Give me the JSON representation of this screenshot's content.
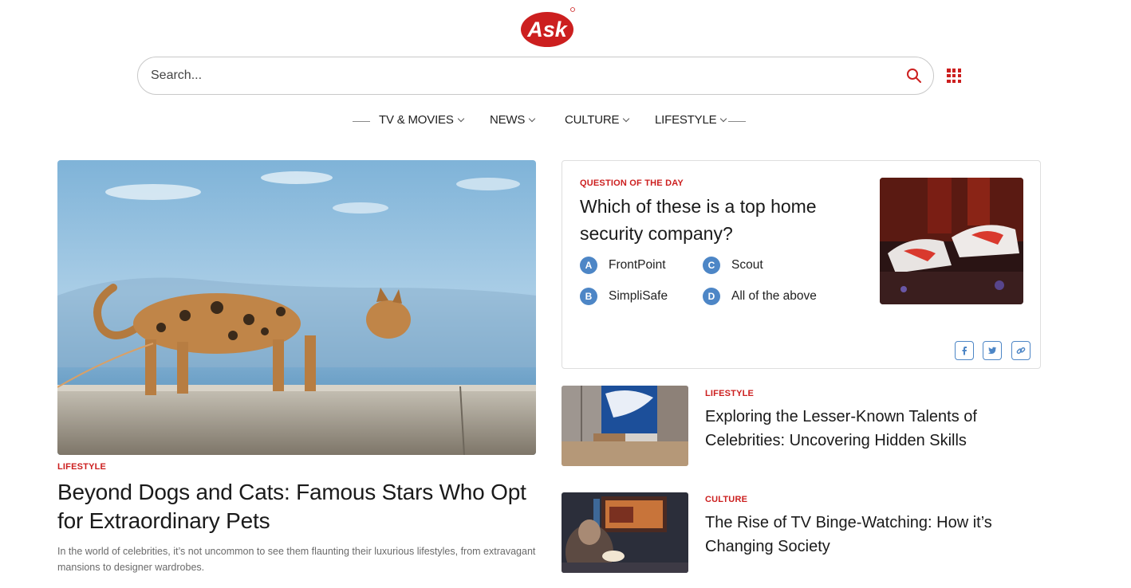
{
  "brand": {
    "logo_text": "Ask",
    "color": "#cc1f1f"
  },
  "search": {
    "placeholder": "Search...",
    "icon": "search-icon"
  },
  "apps_icon": "grid-icon",
  "nav": {
    "items": [
      {
        "label": "TV & MOVIES"
      },
      {
        "label": "NEWS"
      },
      {
        "label": "CULTURE"
      },
      {
        "label": "LIFESTYLE"
      }
    ]
  },
  "hero": {
    "category": "LIFESTYLE",
    "title": "Beyond Dogs and Cats: Famous Stars Who Opt for Extraordinary Pets",
    "description": "In the world of celebrities, it’s not uncommon to see them flaunting their luxurious lifestyles, from extravagant mansions to designer wardrobes."
  },
  "question": {
    "kicker": "QUESTION OF THE DAY",
    "title": "Which of these is a top home security company?",
    "options": [
      {
        "letter": "A",
        "text": "FrontPoint"
      },
      {
        "letter": "B",
        "text": "SimpliSafe"
      },
      {
        "letter": "C",
        "text": "Scout"
      },
      {
        "letter": "D",
        "text": "All of the above"
      }
    ],
    "share_icons": [
      "facebook-icon",
      "twitter-icon",
      "link-icon"
    ],
    "accent": "#4d86c6"
  },
  "articles": [
    {
      "category": "LIFESTYLE",
      "title": "Exploring the Lesser-Known Talents of Celebrities: Uncovering Hidden Skills"
    },
    {
      "category": "CULTURE",
      "title": "The Rise of TV Binge-Watching: How it’s Changing Society"
    }
  ]
}
